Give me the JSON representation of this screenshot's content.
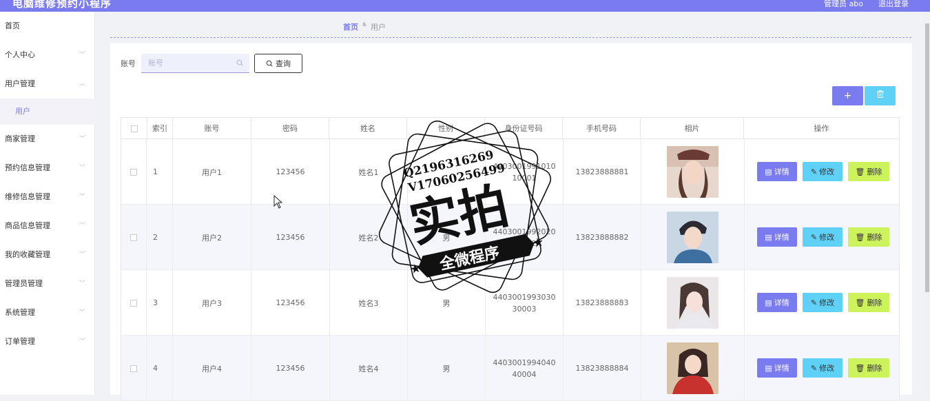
{
  "header": {
    "app_title": "电脑维修预约小程序",
    "user_label": "管理员 abo",
    "logout_label": "退出登录"
  },
  "sidebar": {
    "items": [
      {
        "label": "首页",
        "expandable": false
      },
      {
        "label": "个人中心",
        "expandable": true
      },
      {
        "label": "用户管理",
        "expandable": true,
        "expanded": true
      },
      {
        "label": "用户",
        "sub": true
      },
      {
        "label": "商家管理",
        "expandable": true
      },
      {
        "label": "预约信息管理",
        "expandable": true
      },
      {
        "label": "维修信息管理",
        "expandable": true
      },
      {
        "label": "商品信息管理",
        "expandable": true
      },
      {
        "label": "我的收藏管理",
        "expandable": true
      },
      {
        "label": "管理员管理",
        "expandable": true
      },
      {
        "label": "系统管理",
        "expandable": true
      },
      {
        "label": "订单管理",
        "expandable": true
      }
    ]
  },
  "breadcrumb": {
    "home": "首页",
    "current": "用户"
  },
  "search": {
    "label": "账号",
    "placeholder": "账号",
    "value": "",
    "query_button": "查询"
  },
  "toolbar": {
    "add_label": "+",
    "delete_icon": "trash-icon"
  },
  "table": {
    "columns": [
      "",
      "索引",
      "账号",
      "密码",
      "姓名",
      "性别",
      "身份证号码",
      "手机号码",
      "相片",
      "操作"
    ],
    "rows": [
      {
        "index": "1",
        "account": "用户1",
        "password": "123456",
        "name": "姓名1",
        "gender": "",
        "id_card": "440300199101010001",
        "phone": "13823888881"
      },
      {
        "index": "2",
        "account": "用户2",
        "password": "123456",
        "name": "姓名2",
        "gender": "男",
        "id_card": "440300199202020002",
        "phone": "13823888882"
      },
      {
        "index": "3",
        "account": "用户3",
        "password": "123456",
        "name": "姓名3",
        "gender": "男",
        "id_card": "440300199303030003",
        "phone": "13823888883"
      },
      {
        "index": "4",
        "account": "用户4",
        "password": "123456",
        "name": "姓名4",
        "gender": "男",
        "id_card": "440300199404040004",
        "phone": "13823888884"
      }
    ],
    "actions": {
      "detail": "详情",
      "edit": "修改",
      "delete": "删除"
    }
  },
  "watermark": {
    "line1": "Q2196316269",
    "line2": "V17060256499",
    "big": "实拍",
    "banner": "全微程序"
  },
  "colors": {
    "primary": "#7b7bf0",
    "info": "#5fd0f6",
    "lime": "#ccf25c"
  }
}
